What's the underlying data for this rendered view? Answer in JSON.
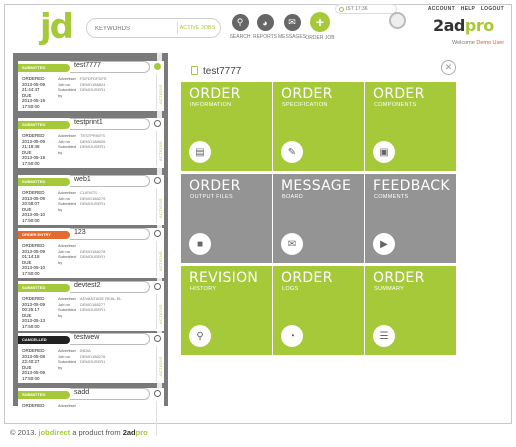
{
  "header": {
    "logo": "jd",
    "search_placeholder": "KEYWORDS",
    "search_button": "ACTIVE JOBS",
    "nav": [
      {
        "label": "SEARCH",
        "icon": "search-icon"
      },
      {
        "label": "REPORTS",
        "icon": "reports-icon"
      },
      {
        "label": "MESSAGES",
        "icon": "messages-icon"
      },
      {
        "label": "ORDER JOB",
        "icon": "plus-icon"
      }
    ],
    "clock": "IST 17:36",
    "toplinks": [
      "ACCOUNT",
      "HELP",
      "LOGOUT"
    ],
    "brand_prefix": "2ad",
    "brand_suffix": "pro",
    "welcome": "Welcome",
    "user": "Demo User"
  },
  "sidebar": {
    "cards": [
      {
        "status": "SUBMITTED",
        "status_color": "green",
        "title": "test7777",
        "ordered": "ORDERED",
        "ordered_date": "2013-05-09",
        "ordered_time": "21:44:47",
        "due": "DUE",
        "due_date": "2013-05-19",
        "due_time": "17:50:00",
        "advertiser_label": "Advertiser",
        "advertiser": "FDFDFDFDFS",
        "job_label": "Job no",
        "job": "DEMO188824",
        "submitted_label": "Submitted by",
        "submitted_by": "DEMOUSER1",
        "actions": "ACTIONS"
      },
      {
        "status": "SUBMITTED",
        "status_color": "green",
        "title": "testprint1",
        "ordered": "ORDERED",
        "ordered_date": "2013-05-09",
        "ordered_time": "21:19:48",
        "due": "DUE",
        "due_date": "2013-05-19",
        "due_time": "17:50:00",
        "advertiser_label": "Advertiser",
        "advertiser": "TESTPRINTS",
        "job_label": "Job no",
        "job": "DEMO188826",
        "submitted_label": "Submitted by",
        "submitted_by": "DEMOUSER1",
        "actions": "ACTIONS"
      },
      {
        "status": "SUBMITTED",
        "status_color": "green",
        "title": "web1",
        "ordered": "ORDERED",
        "ordered_date": "2013-05-09",
        "ordered_time": "20:58:07",
        "due": "DUE",
        "due_date": "2013-05-10",
        "due_time": "17:50:00",
        "advertiser_label": "Advertiser",
        "advertiser": "CLIENTS",
        "job_label": "Job no",
        "job": "DEMO188279",
        "submitted_label": "Submitted by",
        "submitted_by": "DEMOUSER1",
        "actions": "ACTIONS"
      },
      {
        "status": "ORDER ENTRY",
        "status_color": "orange",
        "title": "123",
        "ordered": "ORDERED",
        "ordered_date": "2013-05-09",
        "ordered_time": "01:14:18",
        "due": "DUE",
        "due_date": "2013-05-10",
        "due_time": "17:50:00",
        "advertiser_label": "Advertiser",
        "advertiser": "",
        "job_label": "Job no",
        "job": "DEMO188278",
        "submitted_label": "Submitted by",
        "submitted_by": "DEMOUSER1",
        "actions": "ACTIONS"
      },
      {
        "status": "SUBMITTED",
        "status_color": "green",
        "title": "devtest2",
        "ordered": "ORDERED",
        "ordered_date": "2013-05-09",
        "ordered_time": "00:25:17",
        "due": "DUE",
        "due_date": "2013-05-13",
        "due_time": "17:50:00",
        "advertiser_label": "Advertiser",
        "advertiser": "ADVANTAGE REAL EL",
        "job_label": "Job no",
        "job": "DEMO188277",
        "submitted_label": "Submitted by",
        "submitted_by": "DEMOUSER1",
        "actions": "ACTIONS"
      },
      {
        "status": "CANCELLED",
        "status_color": "black",
        "title": "testwew",
        "ordered": "ORDERED",
        "ordered_date": "2013-05-08",
        "ordered_time": "22:40:27",
        "due": "DUE",
        "due_date": "2013-05-09",
        "due_time": "17:50:00",
        "advertiser_label": "Advertiser",
        "advertiser": "INDIA",
        "job_label": "Job no",
        "job": "DEMO188276",
        "submitted_label": "Submitted by",
        "submitted_by": "DEMOUSER1",
        "actions": "ACTIONS"
      },
      {
        "status": "SUBMITTED",
        "status_color": "green",
        "title": "sadd",
        "ordered": "ORDERED",
        "ordered_date": "",
        "ordered_time": "",
        "due": "",
        "due_date": "",
        "due_time": "",
        "advertiser_label": "Advertiser",
        "advertiser": "",
        "job_label": "",
        "job": "",
        "submitted_label": "",
        "submitted_by": "",
        "actions": ""
      }
    ]
  },
  "main": {
    "title": "test7777",
    "tiles": [
      {
        "title": "ORDER",
        "sub": "INFORMATION",
        "color": "green",
        "icon": "document-icon"
      },
      {
        "title": "ORDER",
        "sub": "SPECIFICATION",
        "color": "green",
        "icon": "spec-icon"
      },
      {
        "title": "ORDER",
        "sub": "COMPONENTS",
        "color": "green",
        "icon": "components-icon"
      },
      {
        "title": "ORDER",
        "sub": "OUTPUT FILES",
        "color": "gray",
        "icon": "files-icon"
      },
      {
        "title": "MESSAGE",
        "sub": "BOARD",
        "color": "gray",
        "icon": "chat-icon"
      },
      {
        "title": "FEEDBACK",
        "sub": "COMMENTS",
        "color": "gray",
        "icon": "megaphone-icon"
      },
      {
        "title": "REVISION",
        "sub": "HISTORY",
        "color": "green",
        "icon": "history-icon"
      },
      {
        "title": "ORDER",
        "sub": "LOGS",
        "color": "green",
        "icon": "logs-icon"
      },
      {
        "title": "ORDER",
        "sub": "SUMMARY",
        "color": "green",
        "icon": "clipboard-icon"
      }
    ]
  },
  "footer": {
    "copyright": "© 2013.",
    "jobdirect": "jobdirect",
    "tagline": "a product from",
    "brand_prefix": "2ad",
    "brand_suffix": "pro"
  },
  "colors": {
    "accent": "#a6c93a",
    "gray_tile": "#949494",
    "orange": "#e56a2f"
  }
}
